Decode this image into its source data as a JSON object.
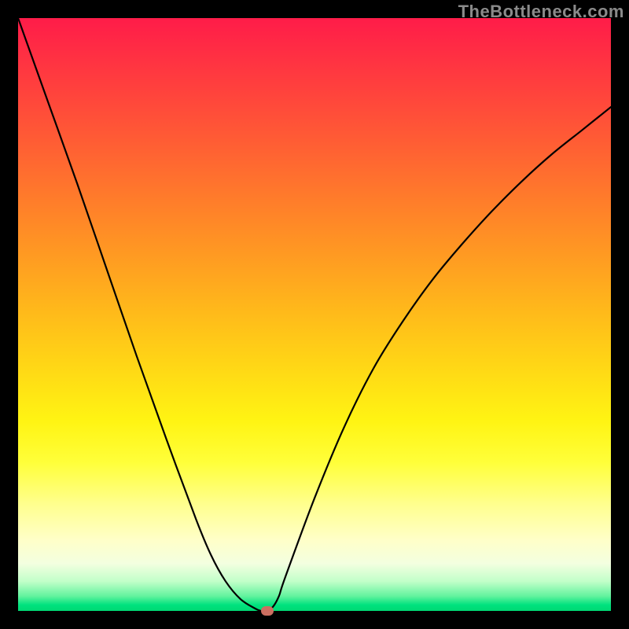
{
  "watermark": "TheBottleneck.com",
  "chart_data": {
    "type": "line",
    "title": "",
    "xlabel": "",
    "ylabel": "",
    "xlim": [
      0,
      1
    ],
    "ylim": [
      0,
      1
    ],
    "series": [
      {
        "name": "bottleneck-curve",
        "x": [
          0.0,
          0.05,
          0.1,
          0.15,
          0.2,
          0.25,
          0.3,
          0.325,
          0.35,
          0.375,
          0.4,
          0.41,
          0.42,
          0.43,
          0.44,
          0.45,
          0.5,
          0.55,
          0.6,
          0.65,
          0.7,
          0.75,
          0.8,
          0.85,
          0.9,
          0.95,
          1.0
        ],
        "y": [
          1.0,
          0.86,
          0.72,
          0.575,
          0.43,
          0.29,
          0.155,
          0.095,
          0.05,
          0.02,
          0.004,
          0.0,
          0.0,
          0.007,
          0.025,
          0.055,
          0.19,
          0.31,
          0.41,
          0.49,
          0.56,
          0.62,
          0.675,
          0.725,
          0.77,
          0.81,
          0.85
        ]
      }
    ],
    "marker": {
      "x": 0.42,
      "y": 0.0,
      "color": "#cc6f61"
    },
    "gradient_top": "#ff1c49",
    "gradient_bottom": "#00d873"
  }
}
